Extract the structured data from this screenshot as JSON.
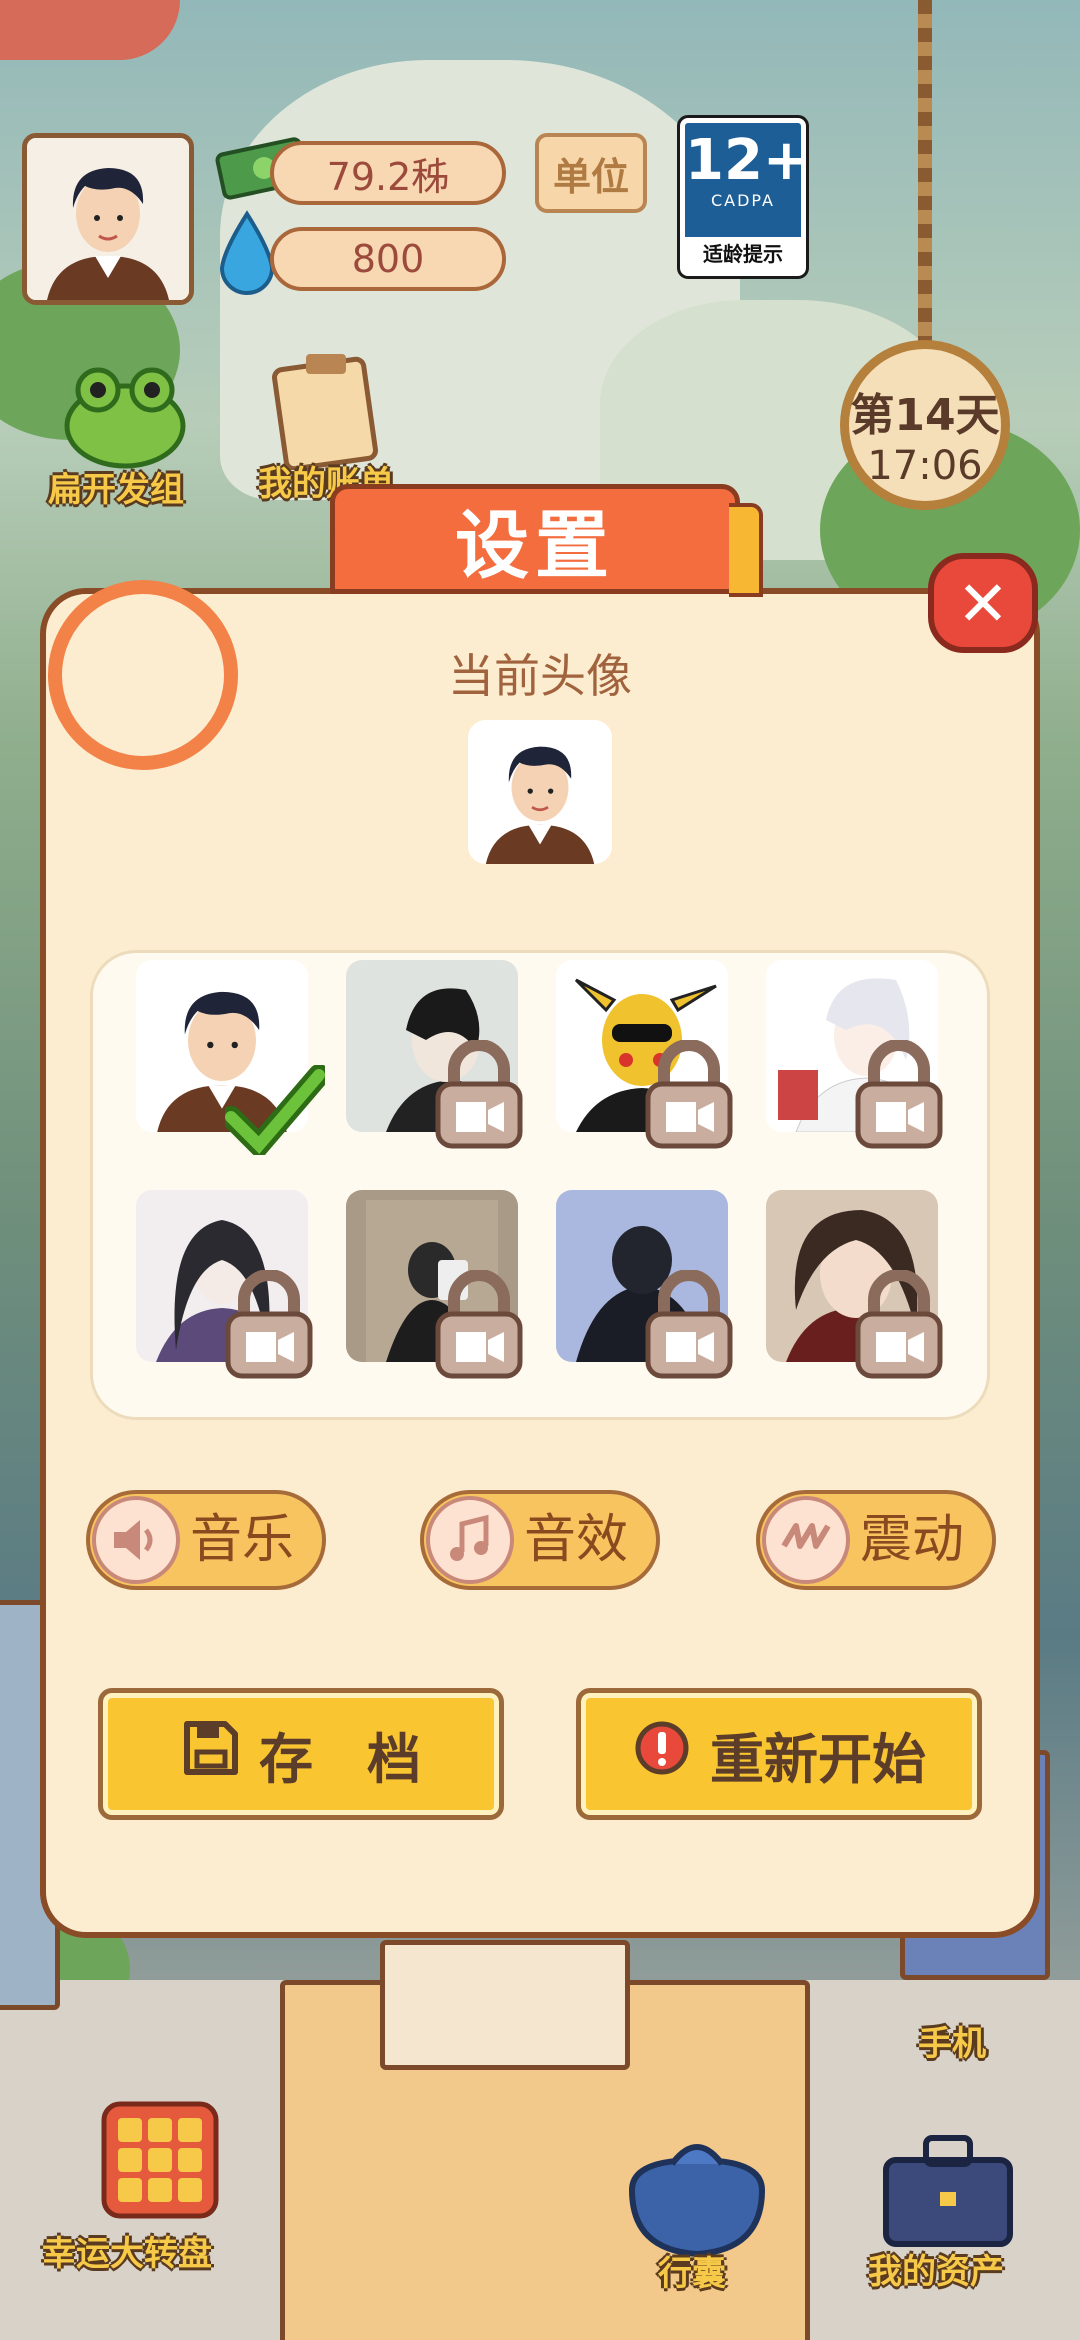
{
  "hud": {
    "money": "79.2秭",
    "water": "800",
    "unit_label": "单位",
    "age_rating": {
      "number": "12+",
      "org": "CADPA",
      "caption": "适龄提示"
    },
    "day": "第14天",
    "time": "17:06",
    "shortcut_left": "扁开发组",
    "shortcut_bill": "我的账单"
  },
  "dialog": {
    "title": "设置",
    "current_avatar_label": "当前头像",
    "avatars": [
      {
        "name": "cartoon-man",
        "selected": true,
        "locked": false
      },
      {
        "name": "dark-hair-man",
        "selected": false,
        "locked": true
      },
      {
        "name": "pikachu-mask",
        "selected": false,
        "locked": true
      },
      {
        "name": "white-hair-anime",
        "selected": false,
        "locked": true
      },
      {
        "name": "long-hair-anime",
        "selected": false,
        "locked": true
      },
      {
        "name": "mirror-selfie",
        "selected": false,
        "locked": true
      },
      {
        "name": "hooded-boy",
        "selected": false,
        "locked": true
      },
      {
        "name": "ancient-anime",
        "selected": false,
        "locked": true
      }
    ],
    "toggles": {
      "music": "音乐",
      "sound": "音效",
      "vibration": "震动"
    },
    "save_label": "存　档",
    "restart_label": "重新开始"
  },
  "bottom": {
    "lucky_wheel": "幸运大转盘",
    "bag": "行囊",
    "assets": "我的资产",
    "phone": "手机"
  },
  "colors": {
    "dialog_bg": "#fdedd0",
    "title_tab": "#f36d3e",
    "button_yellow": "#f9c531",
    "close_red": "#e8493b"
  }
}
